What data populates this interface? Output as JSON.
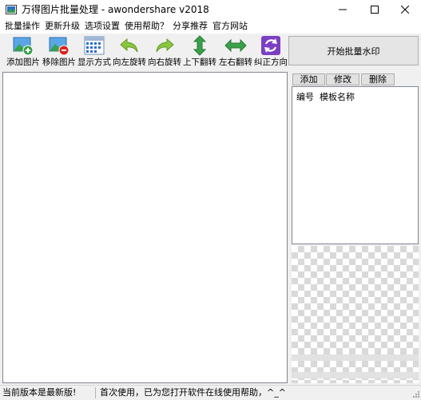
{
  "window": {
    "title": "万得图片批量处理 - awondershare v2018",
    "controls": [
      "minimize-icon",
      "maximize-icon",
      "close-icon"
    ]
  },
  "menu": {
    "items": [
      "批量操作",
      "更新升级",
      "选项设置",
      "使用帮助？",
      "分享推荐",
      "官方网站"
    ]
  },
  "toolbar": {
    "tools": [
      {
        "label": "添加图片",
        "icon": "add-image-icon"
      },
      {
        "label": "移除图片",
        "icon": "remove-image-icon"
      },
      {
        "label": "显示方式",
        "icon": "display-mode-icon"
      },
      {
        "label": "向左旋转",
        "icon": "rotate-left-icon"
      },
      {
        "label": "向右旋转",
        "icon": "rotate-right-icon"
      },
      {
        "label": "上下翻转",
        "icon": "flip-vertical-icon"
      },
      {
        "label": "左右翻转",
        "icon": "flip-horizontal-icon"
      },
      {
        "label": "纠正方向",
        "icon": "correct-orientation-icon"
      }
    ],
    "start_button": "开始批量水印"
  },
  "template_panel": {
    "buttons": [
      "添加",
      "修改",
      "删除"
    ],
    "columns": [
      "编号",
      "模板名称"
    ]
  },
  "status": {
    "left": "当前版本是最新版!",
    "right": "首次使用，已为您打开软件在线使用帮助，^_^"
  },
  "colors": {
    "green": "#3aa04a",
    "yellow_green": "#8cc63f",
    "purple": "#7b3fc4",
    "red": "#d9241d",
    "blue": "#2a6fc9"
  }
}
